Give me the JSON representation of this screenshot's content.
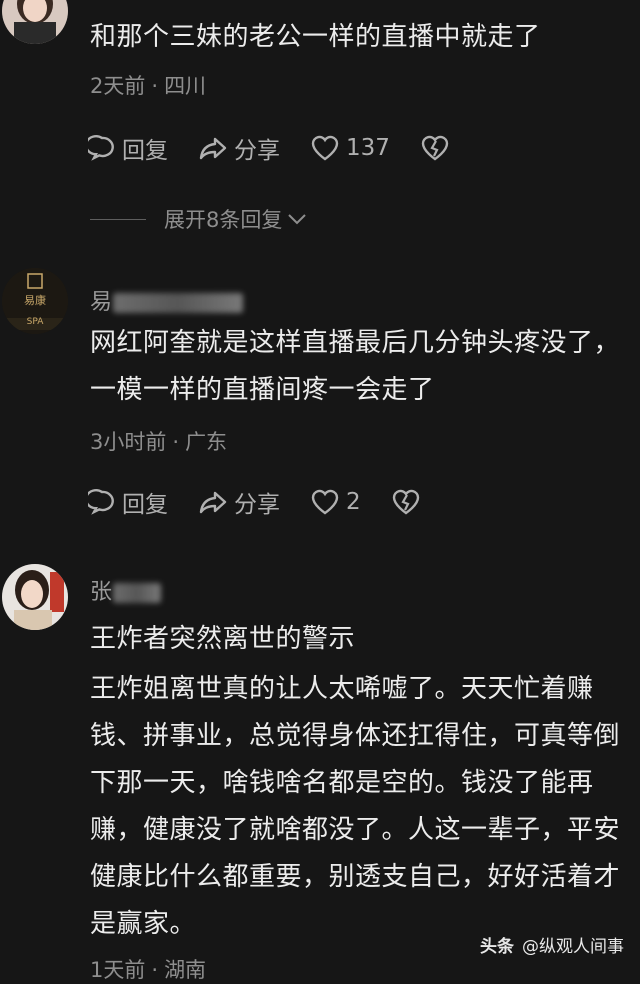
{
  "comments": [
    {
      "text": "和那个三妹的老公一样的直播中就走了",
      "time": "2天前",
      "location": "四川",
      "actions": {
        "reply": "回复",
        "share": "分享",
        "likes": "137"
      },
      "expand_label": "展开8条回复"
    },
    {
      "username_visible": "易",
      "avatar_text": "易康",
      "avatar_sub": "SPA",
      "text": "网红阿奎就是这样直播最后几分钟头疼没了，一模一样的直播间疼一会走了",
      "time": "3小时前",
      "location": "广东",
      "actions": {
        "reply": "回复",
        "share": "分享",
        "likes": "2"
      }
    },
    {
      "username_visible": "张",
      "title": "王炸者突然离世的警示",
      "text": "王炸姐离世真的让人太唏嘘了。天天忙着赚钱、拼事业，总觉得身体还扛得住，可真等倒下那一天，啥钱啥名都是空的。钱没了能再赚，健康没了就啥都没了。人这一辈子，平安健康比什么都重要，别透支自己，好好活着才是赢家。",
      "time": "1天前",
      "location": "湖南"
    }
  ],
  "watermark": {
    "brand": "头条",
    "account": "@纵观人间事"
  },
  "colors": {
    "background": "#161616",
    "text": "#ececec",
    "meta": "#8e8e8e"
  }
}
